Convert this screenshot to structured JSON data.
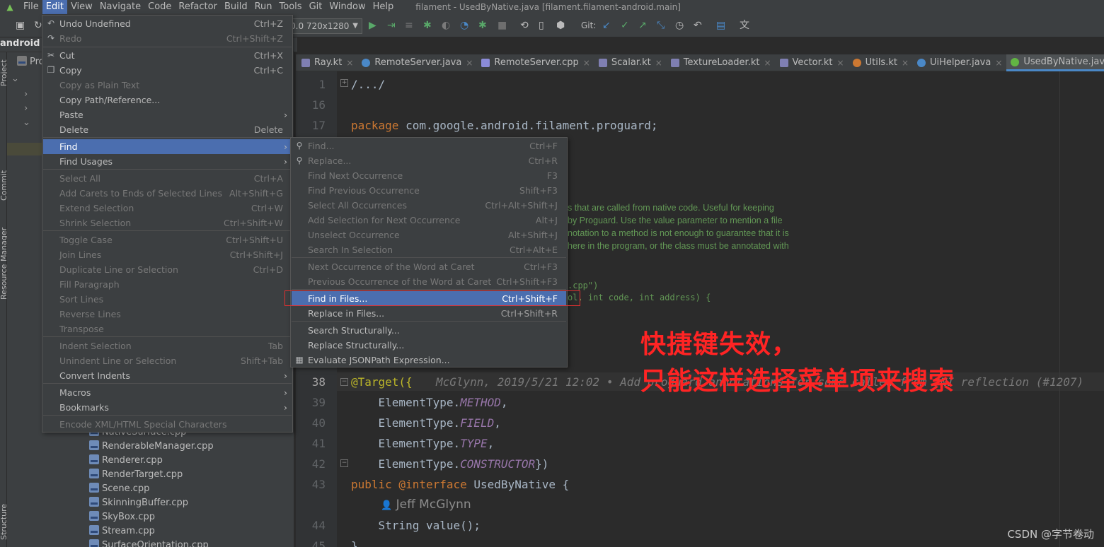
{
  "menubar": {
    "items": [
      "File",
      "Edit",
      "View",
      "Navigate",
      "Code",
      "Refactor",
      "Build",
      "Run",
      "Tools",
      "Git",
      "Window",
      "Help"
    ],
    "title": "filament - UsedByNative.java [filament.filament-android.main]"
  },
  "toolbar": {
    "device": "0.0 720x1280",
    "git_label": "Git:"
  },
  "project": {
    "name": "android",
    "panel_label": "Pro",
    "files": [
      "NativeSurface.cpp",
      "RenderableManager.cpp",
      "Renderer.cpp",
      "RenderTarget.cpp",
      "Scene.cpp",
      "SkinningBuffer.cpp",
      "SkyBox.cpp",
      "Stream.cpp",
      "SurfaceOrientation.cpp"
    ]
  },
  "side_tools": {
    "project": "Project",
    "commit": "Commit",
    "resource_manager": "Resource Manager",
    "structure": "Structure"
  },
  "tabs": [
    {
      "label": "Ray.kt",
      "color": "#7f7fb2"
    },
    {
      "label": "RemoteServer.java",
      "color": "#4a88c7"
    },
    {
      "label": "RemoteServer.cpp",
      "color": "#8b8bd8"
    },
    {
      "label": "Scalar.kt",
      "color": "#7f7fb2"
    },
    {
      "label": "TextureLoader.kt",
      "color": "#7f7fb2"
    },
    {
      "label": "Vector.kt",
      "color": "#7f7fb2"
    },
    {
      "label": "Utils.kt",
      "color": "#cc7832"
    },
    {
      "label": "UiHelper.java",
      "color": "#4a88c7"
    },
    {
      "label": "UsedByNative.java",
      "color": "#62b543"
    }
  ],
  "editor": {
    "line_numbers": {
      "l1": "1",
      "l16": "16",
      "l17": "17",
      "l38": "38",
      "l39": "39",
      "l40": "40",
      "l41": "41",
      "l42": "42",
      "l43": "43",
      "l44": "44",
      "l45": "45"
    },
    "fold_text": "/.../",
    "package_kw": "package",
    "package_name": " com.google.android.filament.proguard;",
    "comment1": "s that are called from native code. Useful for keeping",
    "comment2": "by Proguard. Use the value parameter to mention a file",
    "comment3": "notation to a method is not enough to guarantee that it is",
    "comment4": "here in the program, or the class must be annotated with",
    "snippet1": ".cpp\")",
    "snippet2": "ol, int code, int address) {",
    "target_ann": "@Target({",
    "blame": "McGlynn, 2019/5/21 12:02 • Add proguard annotations for some called from JNI reflection (#1207)",
    "et_prefix": "ElementType.",
    "et_method": "METHOD",
    "et_field": "FIELD",
    "et_type": "TYPE",
    "et_ctor": "CONSTRUCTOR",
    "comma": ",",
    "close": "})",
    "public_kw": "public",
    "interface_kw": " @interface",
    "class_name": " UsedByNative {",
    "author": "Jeff McGlynn",
    "value_decl": "String value();",
    "closing_brace": "}"
  },
  "edit_menu": [
    {
      "label": "Undo Undefined",
      "shortcut": "Ctrl+Z",
      "enabled": true,
      "icon": "undo-icon"
    },
    {
      "label": "Redo",
      "shortcut": "Ctrl+Shift+Z",
      "enabled": false,
      "icon": "redo-icon"
    },
    {
      "label": "Cut",
      "shortcut": "Ctrl+X",
      "enabled": true,
      "icon": "cut-icon"
    },
    {
      "label": "Copy",
      "shortcut": "Ctrl+C",
      "enabled": true,
      "icon": "copy-icon"
    },
    {
      "label": "Copy as Plain Text",
      "shortcut": "",
      "enabled": false
    },
    {
      "label": "Copy Path/Reference...",
      "shortcut": "",
      "enabled": true
    },
    {
      "label": "Paste",
      "shortcut": "",
      "enabled": true,
      "submenu": true
    },
    {
      "label": "Delete",
      "shortcut": "Delete",
      "enabled": true
    },
    {
      "label": "Find",
      "shortcut": "",
      "enabled": true,
      "submenu": true,
      "selected": true
    },
    {
      "label": "Find Usages",
      "shortcut": "",
      "enabled": true,
      "submenu": true
    },
    {
      "label": "Select All",
      "shortcut": "Ctrl+A",
      "enabled": false
    },
    {
      "label": "Add Carets to Ends of Selected Lines",
      "shortcut": "Alt+Shift+G",
      "enabled": false
    },
    {
      "label": "Extend Selection",
      "shortcut": "Ctrl+W",
      "enabled": false
    },
    {
      "label": "Shrink Selection",
      "shortcut": "Ctrl+Shift+W",
      "enabled": false
    },
    {
      "label": "Toggle Case",
      "shortcut": "Ctrl+Shift+U",
      "enabled": false
    },
    {
      "label": "Join Lines",
      "shortcut": "Ctrl+Shift+J",
      "enabled": false
    },
    {
      "label": "Duplicate Line or Selection",
      "shortcut": "Ctrl+D",
      "enabled": false
    },
    {
      "label": "Fill Paragraph",
      "shortcut": "",
      "enabled": false
    },
    {
      "label": "Sort Lines",
      "shortcut": "",
      "enabled": false
    },
    {
      "label": "Reverse Lines",
      "shortcut": "",
      "enabled": false
    },
    {
      "label": "Transpose",
      "shortcut": "",
      "enabled": false
    },
    {
      "label": "Indent Selection",
      "shortcut": "Tab",
      "enabled": false
    },
    {
      "label": "Unindent Line or Selection",
      "shortcut": "Shift+Tab",
      "enabled": false
    },
    {
      "label": "Convert Indents",
      "shortcut": "",
      "enabled": true,
      "submenu": true
    },
    {
      "label": "Macros",
      "shortcut": "",
      "enabled": true,
      "submenu": true
    },
    {
      "label": "Bookmarks",
      "shortcut": "",
      "enabled": true,
      "submenu": true
    },
    {
      "label": "Encode XML/HTML Special Characters",
      "shortcut": "",
      "enabled": false
    }
  ],
  "find_menu": [
    {
      "label": "Find...",
      "shortcut": "Ctrl+F",
      "enabled": false,
      "icon": "search-icon"
    },
    {
      "label": "Replace...",
      "shortcut": "Ctrl+R",
      "enabled": false,
      "icon": "replace-icon"
    },
    {
      "label": "Find Next Occurrence",
      "shortcut": "F3",
      "enabled": false
    },
    {
      "label": "Find Previous Occurrence",
      "shortcut": "Shift+F3",
      "enabled": false
    },
    {
      "label": "Select All Occurrences",
      "shortcut": "Ctrl+Alt+Shift+J",
      "enabled": false
    },
    {
      "label": "Add Selection for Next Occurrence",
      "shortcut": "Alt+J",
      "enabled": false
    },
    {
      "label": "Unselect Occurrence",
      "shortcut": "Alt+Shift+J",
      "enabled": false
    },
    {
      "label": "Search In Selection",
      "shortcut": "Ctrl+Alt+E",
      "enabled": false
    },
    {
      "label": "Next Occurrence of the Word at Caret",
      "shortcut": "Ctrl+F3",
      "enabled": false
    },
    {
      "label": "Previous Occurrence of the Word at Caret",
      "shortcut": "Ctrl+Shift+F3",
      "enabled": false
    },
    {
      "label": "Find in Files...",
      "shortcut": "Ctrl+Shift+F",
      "enabled": true,
      "selected": true
    },
    {
      "label": "Replace in Files...",
      "shortcut": "Ctrl+Shift+R",
      "enabled": true
    },
    {
      "label": "Search Structurally...",
      "shortcut": "",
      "enabled": true
    },
    {
      "label": "Replace Structurally...",
      "shortcut": "",
      "enabled": true
    },
    {
      "label": "Evaluate JSONPath Expression...",
      "shortcut": "",
      "enabled": true,
      "icon": "jsonpath-icon"
    }
  ],
  "annotation": {
    "line1": "快捷键失效，",
    "line2": "只能这样选择菜单项来搜索",
    "color": "#ff2424"
  },
  "watermark": "CSDN @字节卷动"
}
